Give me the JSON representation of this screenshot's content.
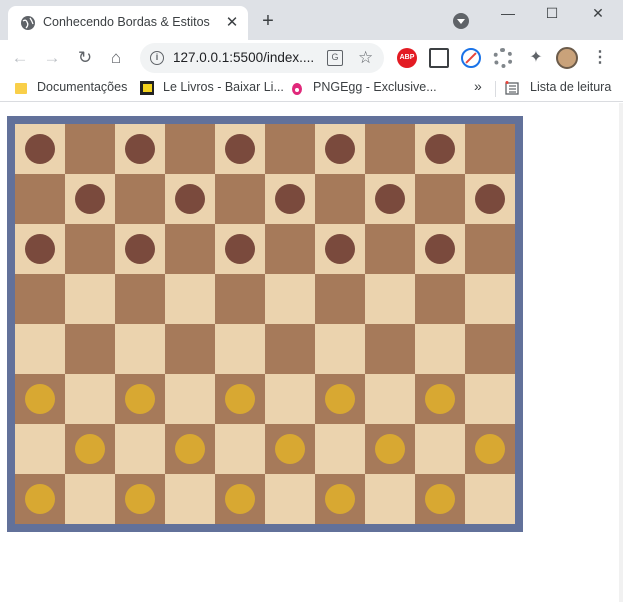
{
  "browser": {
    "tab_title": "Conhecendo Bordas & Estitos",
    "tab_close": "✕",
    "new_tab": "+",
    "window_controls": {
      "minimize": "—",
      "maximize": "☐",
      "close": "✕"
    },
    "url": "127.0.0.1:5500/index....",
    "abp_label": "ABP"
  },
  "bookmarks": [
    {
      "label": "Documentações",
      "icon": "folder-icon"
    },
    {
      "label": "Le Livros - Baixar Li...",
      "icon": "lelivros-icon"
    },
    {
      "label": "PNGEgg - Exclusive...",
      "icon": "pngegg-icon"
    }
  ],
  "bookmarks_overflow": "»",
  "reading_list": "Lista de leitura",
  "board": {
    "columns": 10,
    "rows": 8,
    "colors": {
      "light": "#ebd3ae",
      "dark": "#a67a5a",
      "border": "#62719a",
      "brown_piece": "#7a4a3d",
      "gold_piece": "#d8a832"
    },
    "pieces": [
      "B.B.B.B.B.",
      ".B.B.B.B.B",
      "B.B.B.B.B.",
      "..........",
      "..........",
      "G.G.G.G.G.",
      ".G.G.G.G.G",
      "G.G.G.G.G."
    ]
  }
}
